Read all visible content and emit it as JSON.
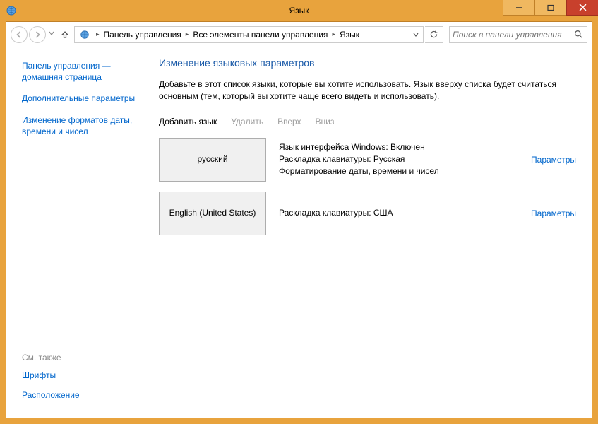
{
  "window": {
    "title": "Язык"
  },
  "breadcrumbs": {
    "item0": "Панель управления",
    "item1": "Все элементы панели управления",
    "item2": "Язык"
  },
  "search": {
    "placeholder": "Поиск в панели управления"
  },
  "sidebar": {
    "home": "Панель управления — домашняя страница",
    "advanced": "Дополнительные параметры",
    "formats": "Изменение форматов даты, времени и чисел",
    "see_also_label": "См. также",
    "fonts": "Шрифты",
    "location": "Расположение"
  },
  "main": {
    "heading": "Изменение языковых параметров",
    "desc": "Добавьте в этот список языки, которые вы хотите использовать. Язык вверху списка будет считаться основным (тем, который вы хотите чаще всего видеть и использовать)."
  },
  "toolbar": {
    "add": "Добавить язык",
    "remove": "Удалить",
    "up": "Вверх",
    "down": "Вниз"
  },
  "langs": {
    "r0": {
      "name": "русский",
      "line1": "Язык интерфейса Windows: Включен",
      "line2": "Раскладка клавиатуры: Русская",
      "line3": "Форматирование даты, времени и чисел",
      "options": "Параметры"
    },
    "r1": {
      "name": "English (United States)",
      "line1": "Раскладка клавиатуры: США",
      "options": "Параметры"
    }
  }
}
